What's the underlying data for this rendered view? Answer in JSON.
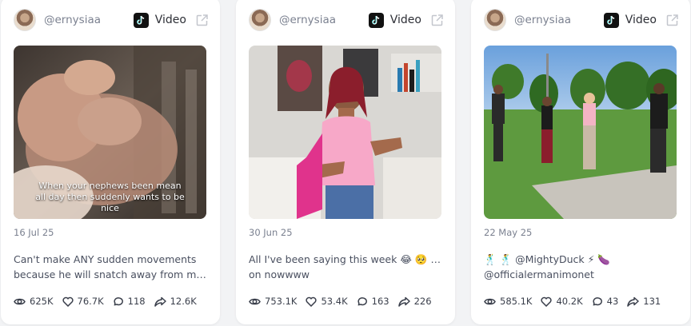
{
  "cards": [
    {
      "username": "@ernysiaa",
      "platform_label": "Video",
      "platform_icon": "tiktok-icon",
      "overlay_text": "When your nephews been mean all day then suddenly wants to be nice",
      "date": "16 Jul 25",
      "description_line1": "Can't make ANY sudden movements",
      "description_line2": "because he will snatch away from me...",
      "stats": {
        "views": "625K",
        "likes": "76.7K",
        "comments": "118",
        "shares": "12.6K"
      }
    },
    {
      "username": "@ernysiaa",
      "platform_label": "Video",
      "platform_icon": "tiktok-icon",
      "date": "30 Jun 25",
      "description_line1": "All I've been saying this week 😂 🥺 come",
      "description_line2": "on nowwww",
      "stats": {
        "views": "753.1K",
        "likes": "53.4K",
        "comments": "163",
        "shares": "226"
      }
    },
    {
      "username": "@ernysiaa",
      "platform_label": "Video",
      "platform_icon": "tiktok-icon",
      "date": "22 May 25",
      "description_line1": "🕺 🕺 @MightyDuck ⚡ 🍆",
      "description_line2": "@officialermanimonet",
      "stats": {
        "views": "585.1K",
        "likes": "40.2K",
        "comments": "43",
        "shares": "131"
      }
    }
  ],
  "colors": {
    "background": "#f2f3f5",
    "card": "#ffffff",
    "muted_text": "#7b8190",
    "icon_stroke": "#3a3f4b"
  }
}
